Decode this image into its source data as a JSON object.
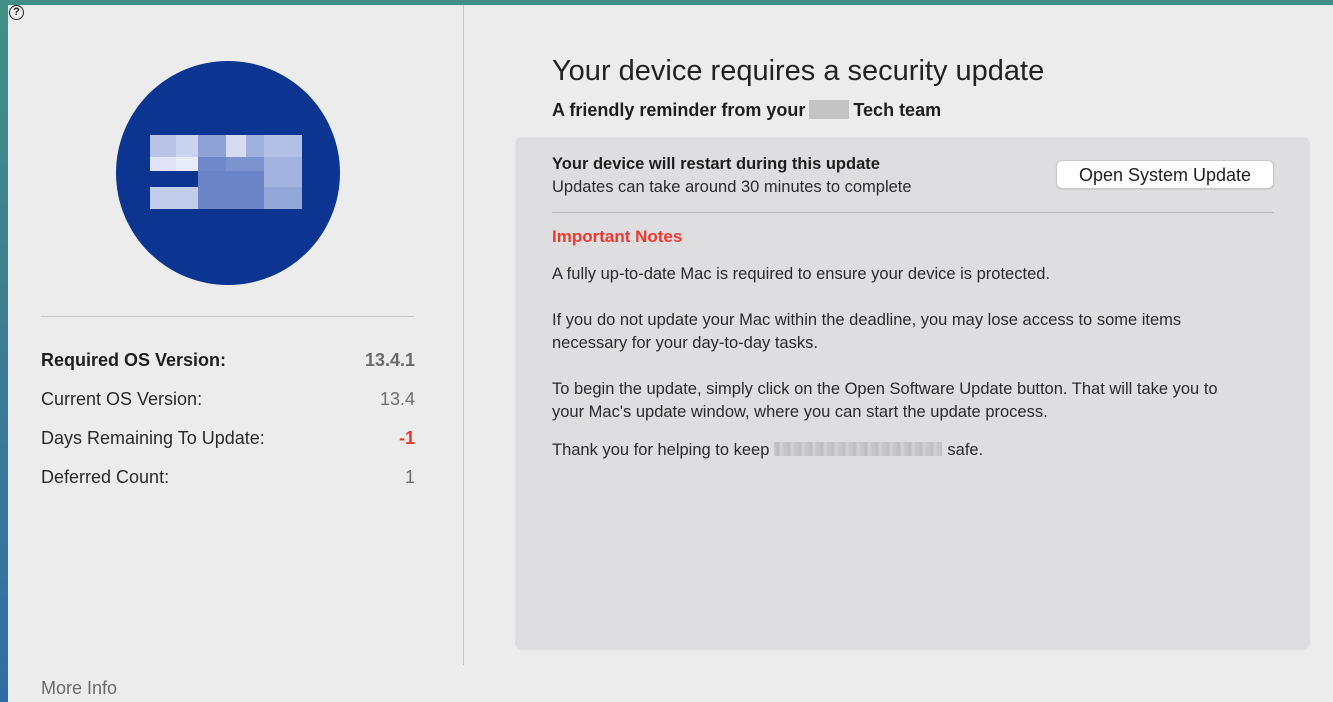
{
  "help": {
    "glyph": "?"
  },
  "left_panel": {
    "logo": {
      "background": "#0c3591",
      "redacted": true
    },
    "info_rows": [
      {
        "label": "Required OS Version:",
        "value": "13.4.1"
      },
      {
        "label": "Current OS Version:",
        "value": "13.4"
      },
      {
        "label": "Days Remaining To Update:",
        "value": "-1"
      },
      {
        "label": "Deferred Count:",
        "value": "1"
      }
    ],
    "more_info_label": "More Info"
  },
  "main": {
    "title": "Your device requires a security update",
    "subtitle_prefix": "A friendly reminder from your",
    "subtitle_suffix": "Tech team",
    "card": {
      "restart_title": "Your device will restart during this update",
      "restart_subtitle": "Updates can take around 30 minutes to complete",
      "open_button_label": "Open System Update",
      "notes_heading": "Important Notes",
      "paragraphs": [
        "A fully up-to-date Mac is required to ensure your device is protected.",
        "If you do not update your Mac within the deadline, you may lose access to some items necessary for your day-to-day tasks.",
        "To begin the update, simply click on the Open Software Update button. That will take you to your Mac's update window, where you can start the update process."
      ],
      "thanks_prefix": "Thank you for helping to keep",
      "thanks_suffix": "safe."
    }
  },
  "colors": {
    "accent_red": "#ea3a2f",
    "negative_value": "#e5372d",
    "logo_blue": "#0c3591",
    "card_bg": "#dedee0",
    "window_bg": "#ececec"
  }
}
